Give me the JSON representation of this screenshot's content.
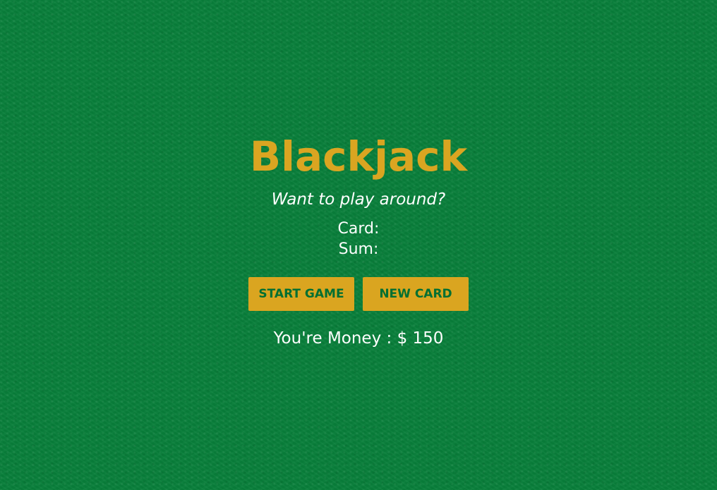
{
  "game": {
    "title": "Blackjack",
    "message": "Want to play around?",
    "cards_label": "Card:",
    "cards_value": "",
    "sum_label": "Sum:",
    "sum_value": "",
    "money_label": "You're Money : $ 150"
  },
  "controls": {
    "start_label": "START GAME",
    "new_card_label": "NEW CARD"
  },
  "colors": {
    "felt": "#087f3a",
    "accent": "#daa520",
    "button_text": "#016f32",
    "text": "#ffffff"
  }
}
